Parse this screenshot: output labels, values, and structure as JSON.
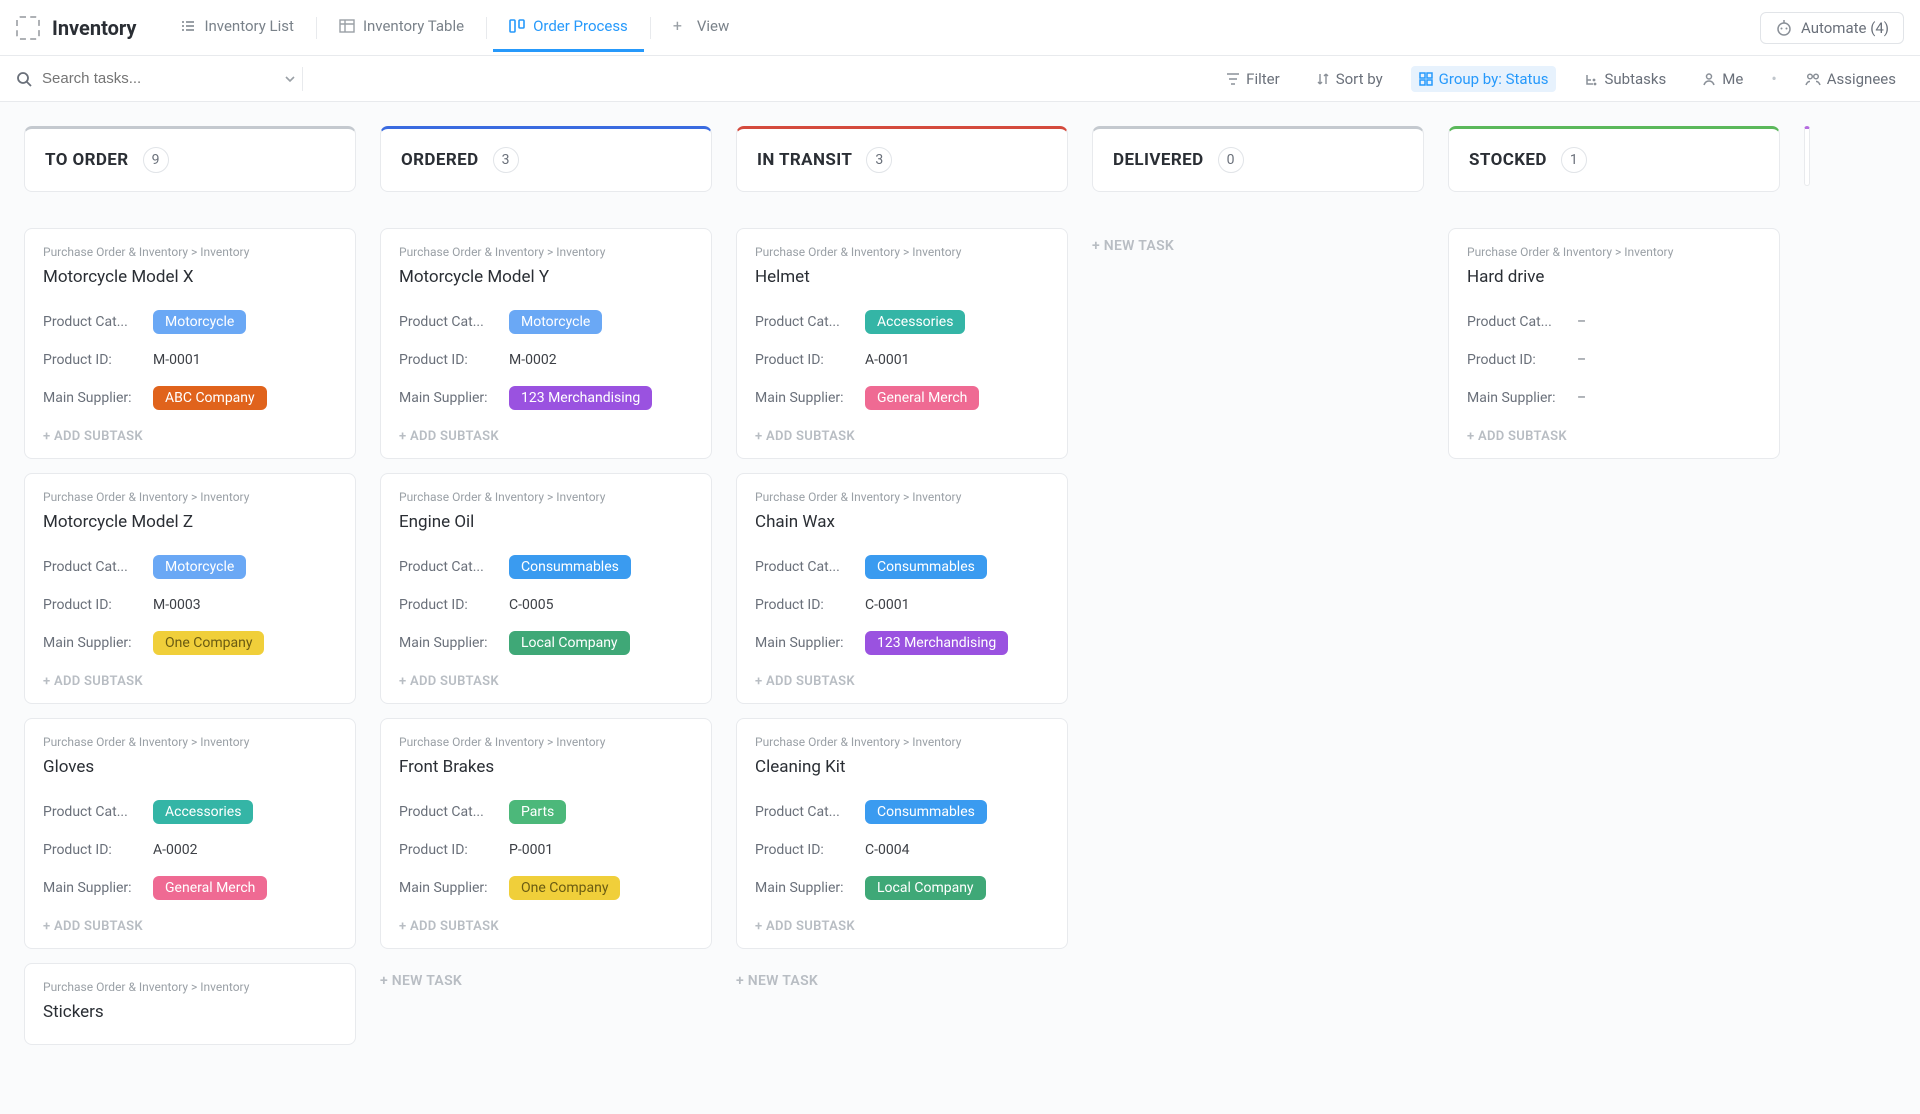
{
  "app_title": "Inventory",
  "tabs": [
    {
      "label": "Inventory List"
    },
    {
      "label": "Inventory Table"
    },
    {
      "label": "Order Process"
    },
    {
      "label": "View"
    }
  ],
  "active_tab": 2,
  "automate": {
    "label": "Automate (4)"
  },
  "search": {
    "placeholder": "Search tasks..."
  },
  "toolbar": {
    "filter": "Filter",
    "sort": "Sort by",
    "group": "Group by: Status",
    "subtasks": "Subtasks",
    "me": "Me",
    "assignees": "Assignees"
  },
  "labels": {
    "product_category": "Product Cat...",
    "product_id": "Product ID:",
    "main_supplier": "Main Supplier:",
    "add_subtask": "+ ADD SUBTASK",
    "new_task": "+ NEW TASK",
    "breadcrumb": "Purchase Order & Inventory  >  Inventory"
  },
  "category_colors": {
    "Motorcycle": "#6aa8f5",
    "Accessories": "#34b5a6",
    "Consummables": "#3a9bf0",
    "Parts": "#4cb87a"
  },
  "supplier_colors": {
    "ABC Company": "#e0631c",
    "123 Merchandising": "#9a52e0",
    "One Company": "#f0cf3a",
    "General Merch": "#ef6a93",
    "Local Company": "#3fa877"
  },
  "columns": [
    {
      "title": "TO ORDER",
      "count": 9,
      "color": "#c4c9cf",
      "cards": [
        {
          "title": "Motorcycle Model X",
          "category": "Motorcycle",
          "product_id": "M-0001",
          "supplier": "ABC Company"
        },
        {
          "title": "Motorcycle Model Z",
          "category": "Motorcycle",
          "product_id": "M-0003",
          "supplier": "One Company"
        },
        {
          "title": "Gloves",
          "category": "Accessories",
          "product_id": "A-0002",
          "supplier": "General Merch"
        },
        {
          "title": "Stickers",
          "partial": true
        }
      ]
    },
    {
      "title": "ORDERED",
      "count": 3,
      "color": "#3a6be0",
      "cards": [
        {
          "title": "Motorcycle Model Y",
          "category": "Motorcycle",
          "product_id": "M-0002",
          "supplier": "123 Merchandising"
        },
        {
          "title": "Engine Oil",
          "category": "Consummables",
          "product_id": "C-0005",
          "supplier": "Local Company"
        },
        {
          "title": "Front Brakes",
          "category": "Parts",
          "product_id": "P-0001",
          "supplier": "One Company"
        }
      ],
      "show_new_task": true
    },
    {
      "title": "IN TRANSIT",
      "count": 3,
      "color": "#d44a3d",
      "cards": [
        {
          "title": "Helmet",
          "category": "Accessories",
          "product_id": "A-0001",
          "supplier": "General Merch"
        },
        {
          "title": "Chain Wax",
          "category": "Consummables",
          "product_id": "C-0001",
          "supplier": "123 Merchandising"
        },
        {
          "title": "Cleaning Kit",
          "category": "Consummables",
          "product_id": "C-0004",
          "supplier": "Local Company"
        }
      ],
      "show_new_task": true
    },
    {
      "title": "DELIVERED",
      "count": 0,
      "color": "#c4c9cf",
      "cards": [],
      "show_new_task": true
    },
    {
      "title": "STOCKED",
      "count": 1,
      "color": "#5bb85b",
      "cards": [
        {
          "title": "Hard drive",
          "category": null,
          "product_id": null,
          "supplier": null
        }
      ]
    }
  ]
}
